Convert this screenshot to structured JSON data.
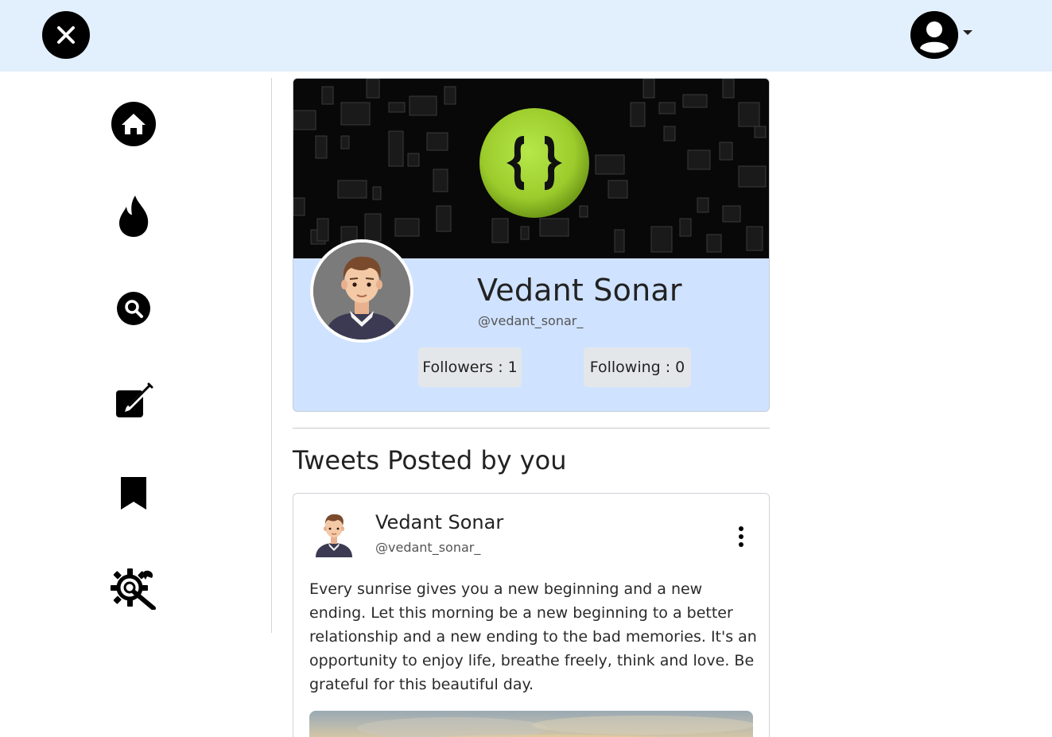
{
  "header": {
    "logo_icon": "x-logo-icon",
    "account_icon": "user-circle-icon",
    "account_menu_icon": "caret-down-icon"
  },
  "sidebar": {
    "items": [
      {
        "name": "home",
        "icon": "home-icon"
      },
      {
        "name": "trending",
        "icon": "fire-icon"
      },
      {
        "name": "search",
        "icon": "search-icon"
      },
      {
        "name": "compose",
        "icon": "compose-icon"
      },
      {
        "name": "bookmarks",
        "icon": "bookmark-icon"
      },
      {
        "name": "settings",
        "icon": "settings-tools-icon"
      }
    ]
  },
  "profile": {
    "name": "Vedant Sonar",
    "handle": "@vedant_sonar_",
    "followers_label": "Followers : 1",
    "following_label": "Following : 0",
    "banner_color": "#080808",
    "card_color": "#cfe2ff",
    "logo_color": "#a4d62e"
  },
  "tweets_section": {
    "title": "Tweets Posted by you"
  },
  "tweet": {
    "author_name": "Vedant Sonar",
    "author_handle": "@vedant_sonar_",
    "menu_icon": "kebab-menu-icon",
    "body": "Every sunrise gives you a new beginning and a new ending. Let this morning be a new beginning to a better relationship and a new ending to the bad memories. It's an opportunity to enjoy life, breathe freely, think and love. Be grateful for this beautiful day."
  }
}
